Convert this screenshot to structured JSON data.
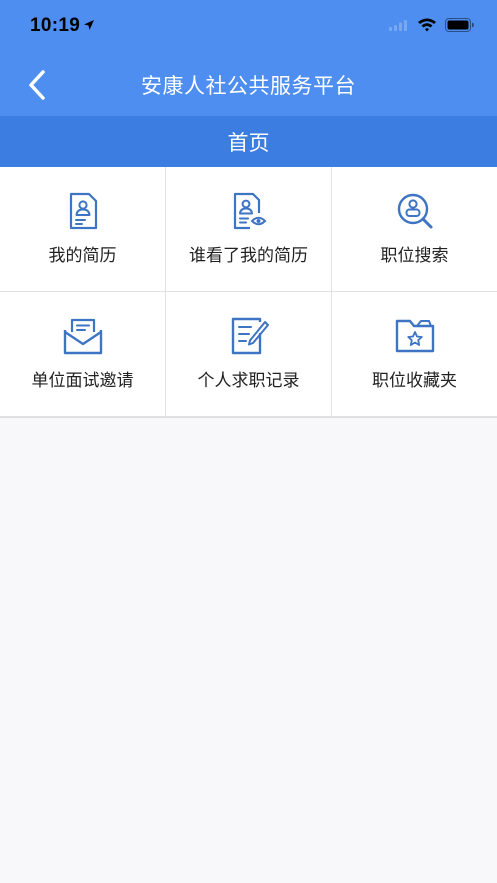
{
  "status_bar": {
    "time": "10:19"
  },
  "navbar": {
    "title": "安康人社公共服务平台"
  },
  "subbar": {
    "title": "首页"
  },
  "grid": {
    "items": [
      {
        "label": "我的简历",
        "icon": "resume-icon"
      },
      {
        "label": "谁看了我的简历",
        "icon": "resume-viewed-icon"
      },
      {
        "label": "职位搜索",
        "icon": "job-search-icon"
      },
      {
        "label": "单位面试邀请",
        "icon": "mail-invitation-icon"
      },
      {
        "label": "个人求职记录",
        "icon": "edit-record-icon"
      },
      {
        "label": "职位收藏夹",
        "icon": "star-folder-icon"
      }
    ]
  },
  "colors": {
    "header": "#4d8ef0",
    "subbar": "#3b7de0",
    "icon": "#3d74c4",
    "background": "#f8f8fa"
  }
}
